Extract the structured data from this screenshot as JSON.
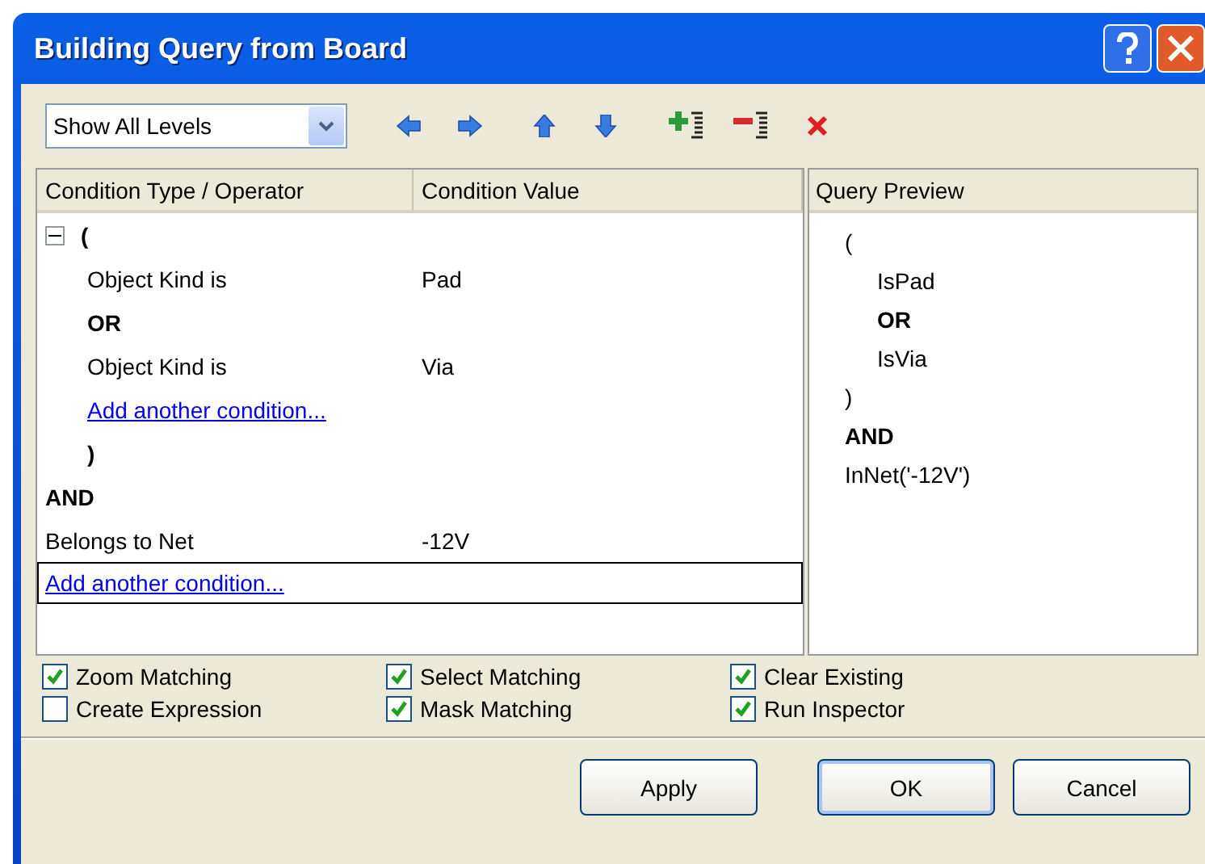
{
  "window": {
    "title": "Building Query from Board"
  },
  "toolbar": {
    "level_dropdown": {
      "value": "Show All Levels"
    }
  },
  "table": {
    "columns": [
      "Condition Type / Operator",
      "Condition Value"
    ],
    "rows": [
      {
        "kind": "group",
        "open": "(",
        "close": ")",
        "expanded": true,
        "children": [
          {
            "kind": "condition",
            "type": "Object Kind is",
            "value": "Pad"
          },
          {
            "kind": "operator",
            "label": "OR"
          },
          {
            "kind": "condition",
            "type": "Object Kind is",
            "value": "Via"
          },
          {
            "kind": "link",
            "label": "Add another condition...",
            "selected": false
          }
        ]
      },
      {
        "kind": "operator",
        "label": "AND"
      },
      {
        "kind": "condition",
        "type": "Belongs to Net",
        "value": "-12V"
      },
      {
        "kind": "link",
        "label": "Add another condition...",
        "selected": true
      }
    ]
  },
  "preview": {
    "title": "Query Preview",
    "lines": [
      {
        "kind": "group",
        "open": "(",
        "close": ")",
        "children": [
          {
            "kind": "plain",
            "text": "IsPad"
          },
          {
            "kind": "bold",
            "text": "OR"
          },
          {
            "kind": "plain",
            "text": "IsVia"
          }
        ]
      },
      {
        "kind": "bold",
        "text": "AND"
      },
      {
        "kind": "plain",
        "text": "InNet('-12V')"
      }
    ]
  },
  "options": [
    {
      "label": "Zoom Matching",
      "checked": true
    },
    {
      "label": "Select Matching",
      "checked": true
    },
    {
      "label": "Clear Existing",
      "checked": true
    },
    {
      "label": "Create Expression",
      "checked": false
    },
    {
      "label": "Mask Matching",
      "checked": true
    },
    {
      "label": "Run Inspector",
      "checked": true
    }
  ],
  "buttons": [
    {
      "label": "Apply",
      "default": false
    },
    {
      "label": "OK",
      "default": true
    },
    {
      "label": "Cancel",
      "default": false
    }
  ]
}
